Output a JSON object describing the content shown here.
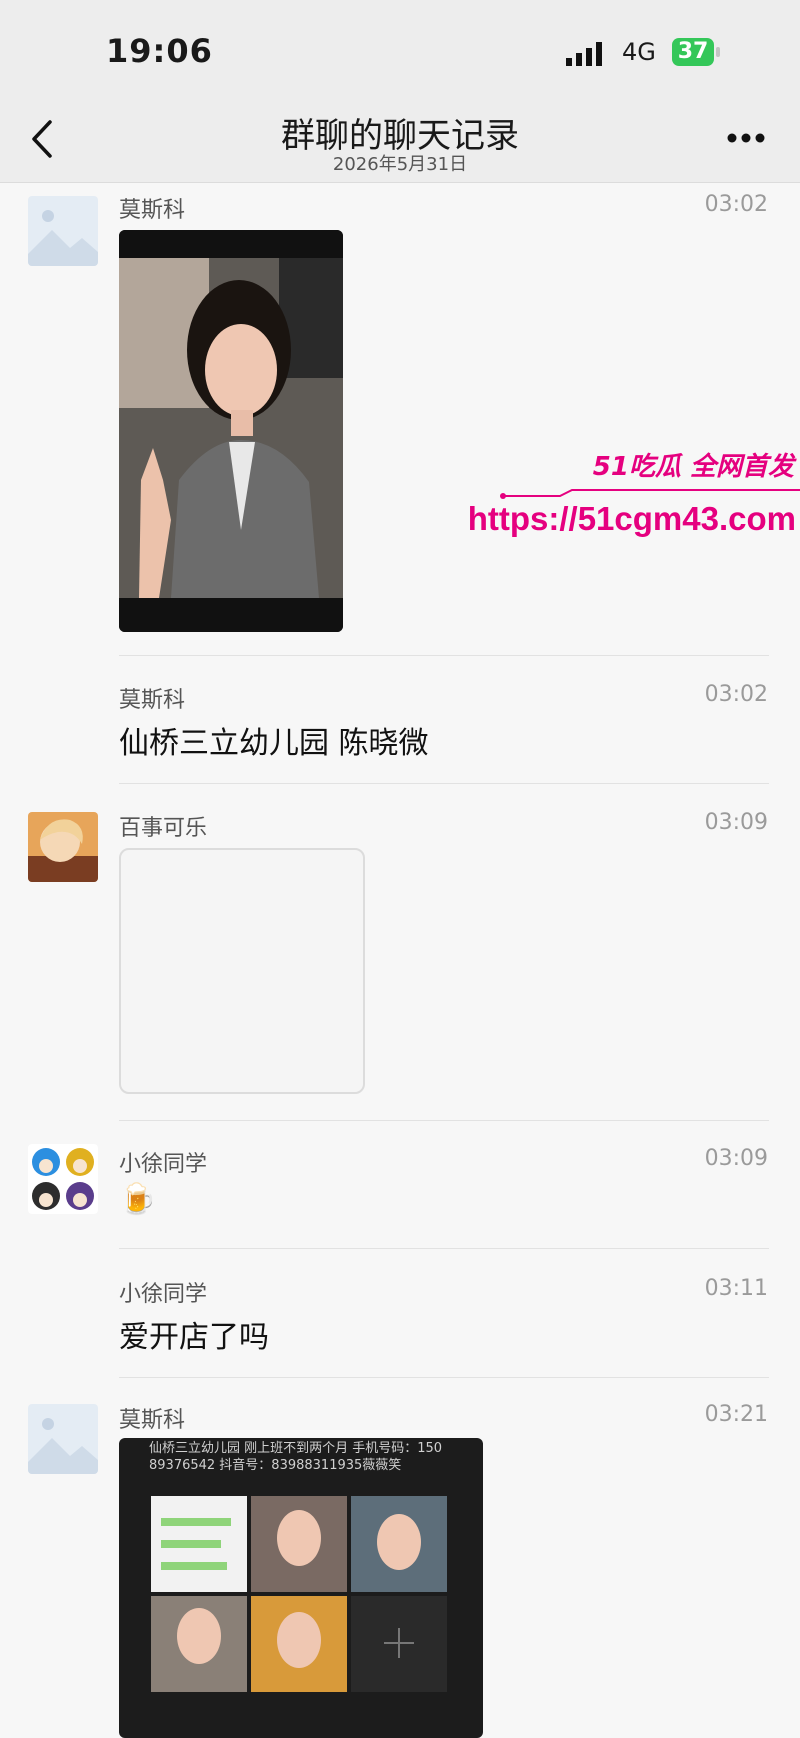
{
  "status_bar": {
    "time": "19:06",
    "network": "4G",
    "battery": "37"
  },
  "header": {
    "title": "群聊的聊天记录",
    "date": "2026年5月31日"
  },
  "messages": [
    {
      "sender": "莫斯科",
      "time": "03:02",
      "type": "image",
      "image": "selfie-photo"
    },
    {
      "sender": "莫斯科",
      "time": "03:02",
      "type": "text",
      "text": "仙桥三立幼儿园 陈晓微"
    },
    {
      "sender": "百事可乐",
      "time": "03:09",
      "type": "image",
      "image": "blank-image"
    },
    {
      "sender": "小徐同学",
      "time": "03:09",
      "type": "emoji",
      "emoji": "🍺"
    },
    {
      "sender": "小徐同学",
      "time": "03:11",
      "type": "text",
      "text": "爱开店了吗"
    },
    {
      "sender": "莫斯科",
      "time": "03:21",
      "type": "image",
      "image": "photo-collage",
      "image_caption": "仙桥三立幼儿园 刚上班不到两个月 手机号码：150 89376542 抖音号：83988311935薇薇笑"
    }
  ],
  "watermark": {
    "brand": "51吃瓜 全网首发",
    "url": "https://51cgm43.com"
  },
  "colors": {
    "watermark": "#e5007f",
    "battery": "#34c759",
    "background": "#f7f7f7",
    "header": "#ededed"
  }
}
